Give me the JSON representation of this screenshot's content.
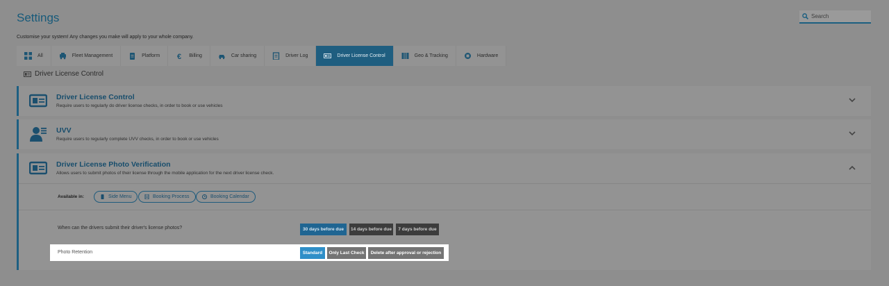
{
  "header": {
    "title": "Settings",
    "subtitle": "Customise your system! Any changes you make will apply to your whole company.",
    "search_placeholder": "Search"
  },
  "tabs": [
    {
      "label": "All",
      "icon": "grid-icon",
      "active": false
    },
    {
      "label": "Fleet Management",
      "icon": "car-icon",
      "active": false
    },
    {
      "label": "Platform",
      "icon": "clipboard-icon",
      "active": false
    },
    {
      "label": "Billing",
      "icon": "euro-icon",
      "active": false
    },
    {
      "label": "Car sharing",
      "icon": "car-share-icon",
      "active": false
    },
    {
      "label": "Driver Log",
      "icon": "log-icon",
      "active": false
    },
    {
      "label": "Driver License Control",
      "icon": "id-card-icon",
      "active": true
    },
    {
      "label": "Geo & Tracking",
      "icon": "map-icon",
      "active": false
    },
    {
      "label": "Hardware",
      "icon": "chip-icon",
      "active": false
    }
  ],
  "section": {
    "heading": "Driver License Control"
  },
  "cards": [
    {
      "title": "Driver License Control",
      "description": "Require users to regularly do driver license checks, in order to book or use vehicles",
      "expanded": false
    },
    {
      "title": "UVV",
      "description": "Require users to regularly complete UVV checks, in order to book or use vehicles",
      "expanded": false
    },
    {
      "title": "Driver License Photo Verification",
      "description": "Allows users to submit photos of their license through the mobile application for the next driver license check.",
      "expanded": true
    }
  ],
  "photo_verification": {
    "available_label": "Available in:",
    "available_in": [
      "Side Menu",
      "Booking Process",
      "Booking Calendar"
    ],
    "question": "When can the drivers submit their driver's license photos?",
    "submit_options": [
      "30 days before due",
      "14 days before due",
      "7 days before due"
    ],
    "submit_selected": "30 days before due",
    "retention_label": "Photo Retention",
    "retention_options": [
      "Standard",
      "Only Last Check",
      "Delete after approval or rejection"
    ],
    "retention_selected": "Standard"
  },
  "colors": {
    "accent": "#1f5e80",
    "background": "#8e8e8e",
    "highlight": "#ffffff",
    "primary_button": "#2f8fc8"
  }
}
